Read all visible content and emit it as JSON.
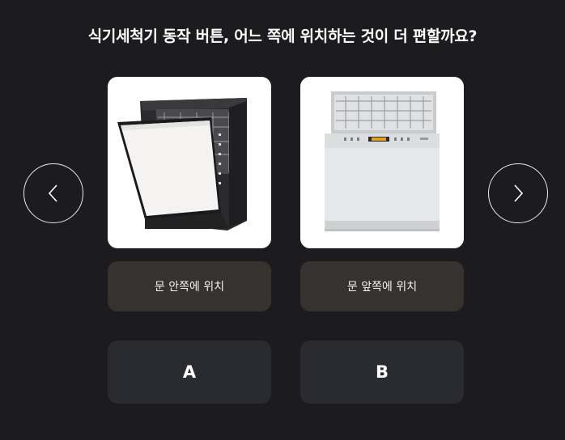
{
  "question": "식기세척기 동작 버튼, 어느 쪽에 위치하는 것이 더 편할까요?",
  "nav": {
    "prev_icon": "chevron-left-icon",
    "next_icon": "chevron-right-icon"
  },
  "options": [
    {
      "description": "문 안쪽에 위치",
      "choice_label": "A"
    },
    {
      "description": "문 앞쪽에 위치",
      "choice_label": "B"
    }
  ],
  "colors": {
    "background": "#1c1c1f",
    "description_bg": "#36322f",
    "choice_bg": "#2a2b31",
    "text": "#ffffff"
  }
}
